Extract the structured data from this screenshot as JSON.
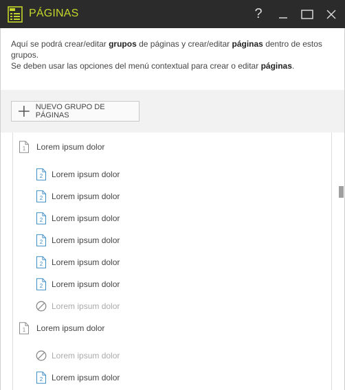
{
  "window": {
    "title": "PÁGINAS",
    "help_label": "?",
    "icons": {
      "app": "pages-app-icon",
      "minimize": "minimize-icon",
      "maximize": "maximize-icon",
      "close": "close-icon"
    },
    "accent_color": "#c5d72a",
    "titlebar_color": "#2b2b2b"
  },
  "intro": {
    "line1_a": "Aquí se podrá crear/editar ",
    "line1_b": "grupos",
    "line1_c": " de páginas y crear/editar ",
    "line1_d": "páginas",
    "line1_e": " dentro de estos grupos.",
    "line2_a": "Se deben usar las opciones del menú contextual para crear o editar ",
    "line2_b": "páginas",
    "line2_c": "."
  },
  "toolbar": {
    "new_group_label": "NUEVO GRUPO DE PÁGINAS"
  },
  "tree": {
    "groups": [
      {
        "label": "Lorem ipsum dolor",
        "badge": "1",
        "pages": [
          {
            "label": "Lorem ipsum dolor",
            "badge": "2",
            "disabled": false
          },
          {
            "label": "Lorem ipsum dolor",
            "badge": "2",
            "disabled": false
          },
          {
            "label": "Lorem ipsum dolor",
            "badge": "2",
            "disabled": false
          },
          {
            "label": "Lorem ipsum dolor",
            "badge": "2",
            "disabled": false
          },
          {
            "label": "Lorem ipsum dolor",
            "badge": "2",
            "disabled": false
          },
          {
            "label": "Lorem ipsum dolor",
            "badge": "2",
            "disabled": false
          },
          {
            "label": "Lorem ipsum dolor",
            "disabled": true
          }
        ]
      },
      {
        "label": "Lorem ipsum dolor",
        "badge": "1",
        "pages": [
          {
            "label": "Lorem ipsum dolor",
            "disabled": true
          },
          {
            "label": "Lorem ipsum dolor",
            "badge": "2",
            "disabled": false
          }
        ]
      }
    ]
  }
}
